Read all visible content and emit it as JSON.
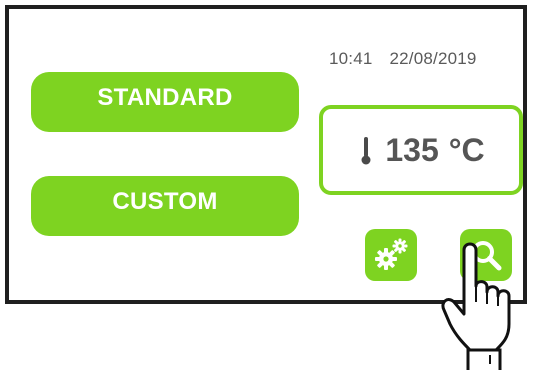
{
  "status": {
    "time": "10:41",
    "date": "22/08/2019"
  },
  "buttons": {
    "standard": "STANDARD",
    "custom": "CUSTOM"
  },
  "temperature": {
    "value": "135",
    "unit": "°C"
  },
  "icons": {
    "thermometer": "thermometer-icon",
    "settings": "gears-icon",
    "search": "magnifier-icon",
    "pointer": "pointing-hand"
  },
  "colors": {
    "accent": "#7ed321",
    "frame": "#1f1f1f",
    "text": "#555555"
  }
}
